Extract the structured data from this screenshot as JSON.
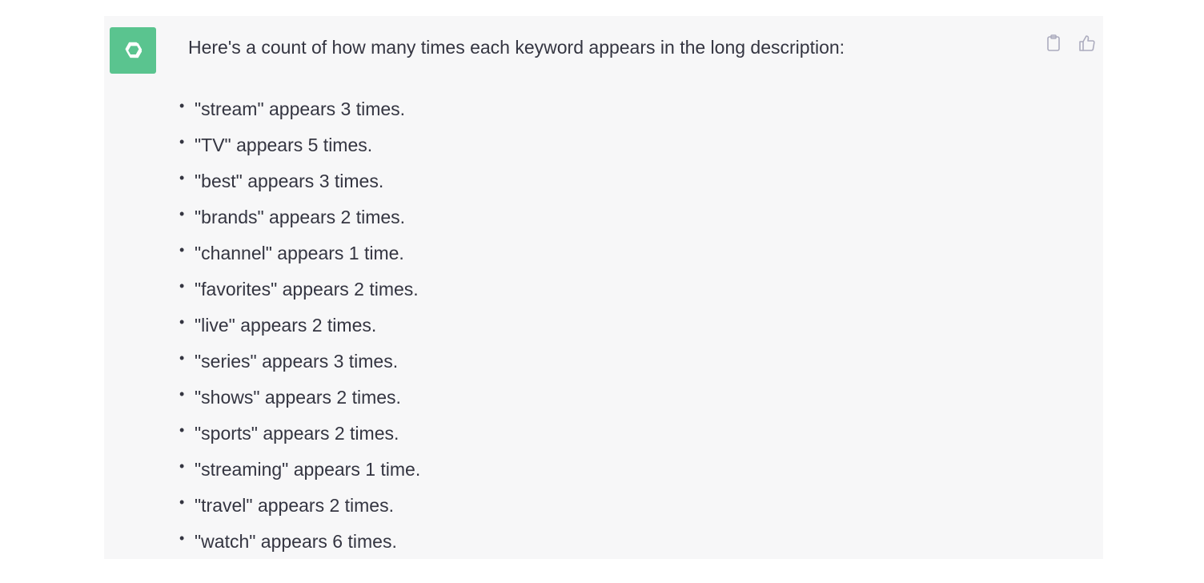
{
  "message": {
    "intro": "Here's a count of how many times each keyword appears in the long description:",
    "items": [
      "\"stream\" appears 3 times.",
      "\"TV\" appears 5 times.",
      "\"best\" appears 3 times.",
      "\"brands\" appears 2 times.",
      "\"channel\" appears 1 time.",
      "\"favorites\" appears 2 times.",
      "\"live\" appears 2 times.",
      "\"series\" appears 3 times.",
      "\"shows\" appears 2 times.",
      "\"sports\" appears 2 times.",
      "\"streaming\" appears 1 time.",
      "\"travel\" appears 2 times.",
      "\"watch\" appears 6 times."
    ]
  },
  "avatar": {
    "icon": "openai-logo-icon",
    "color": "#5ac48f"
  },
  "actions": {
    "copy_icon": "clipboard-icon",
    "like_icon": "thumbs-up-icon"
  },
  "colors": {
    "card_background": "#f7f7f8",
    "text": "#343541",
    "icon": "#acacbe"
  }
}
